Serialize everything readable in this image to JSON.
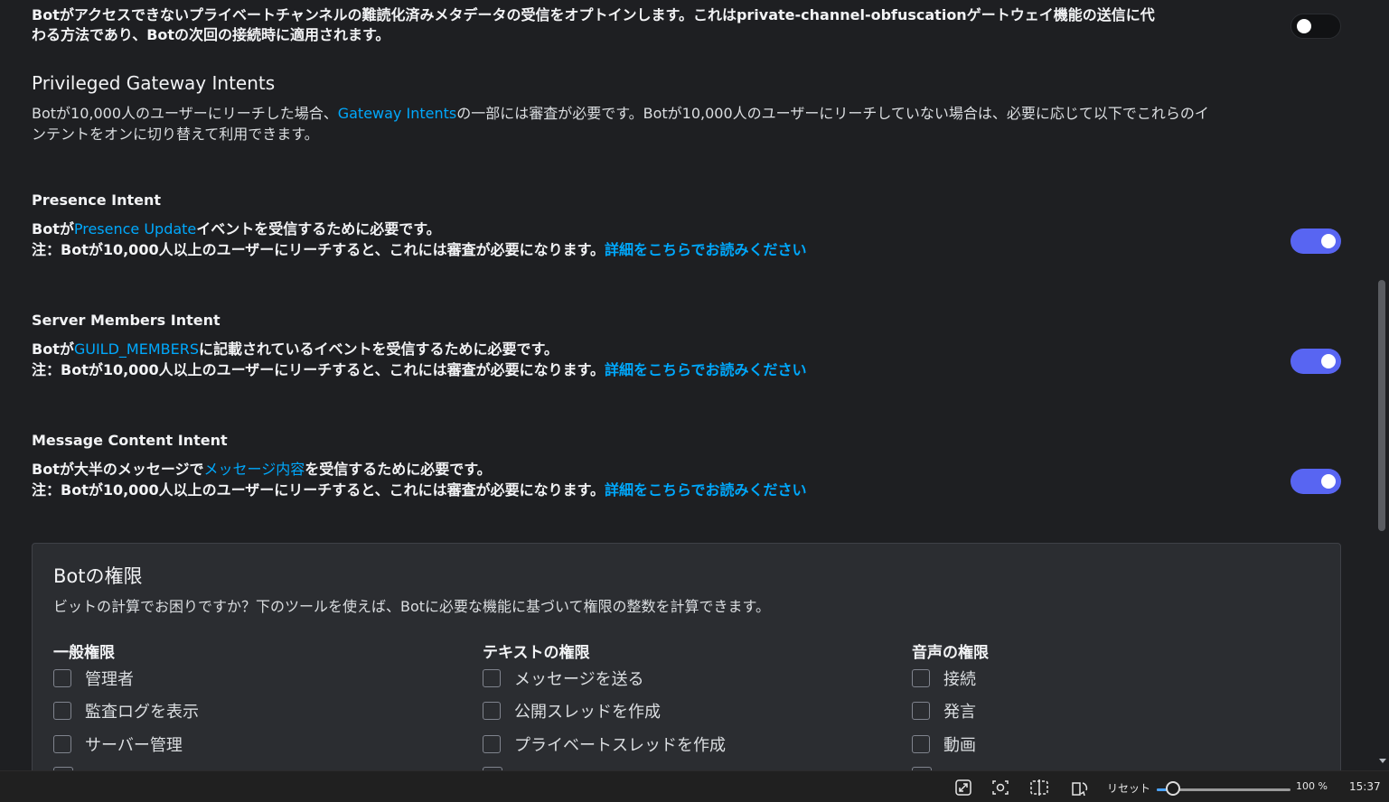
{
  "intro": {
    "line1": "Botがアクセスできないプライベートチャンネルの難読化済みメタデータの受信をオプトインします。これはprivate-channel-obfuscationゲートウェイ機能の送信に代",
    "line2": "わる方法であり、Botの次回の接続時に適用されます。",
    "toggle_on": false
  },
  "privileged": {
    "title": "Privileged Gateway Intents",
    "desc_pre": "Botが10,000人のユーザーにリーチした場合、",
    "desc_link": "Gateway Intents",
    "desc_post": "の一部には審査が必要です。Botが10,000人のユーザーにリーチしていない場合は、必要に応じて以下でこれらのイ",
    "desc_line2": "ンテントをオンに切り替えて利用できます。"
  },
  "intents": [
    {
      "title": "Presence Intent",
      "desc_pre": "Botが",
      "desc_link": "Presence Update",
      "desc_post": "イベントを受信するために必要です。",
      "note": "注：Botが10,000人以上のユーザーにリーチすると、これには審査が必要になります。",
      "note_link": "詳細をこちらでお読みください",
      "toggle_on": true
    },
    {
      "title": "Server Members Intent",
      "desc_pre": "Botが",
      "desc_link": "GUILD_MEMBERS",
      "desc_post": "に記載されているイベントを受信するために必要です。",
      "note": "注：Botが10,000人以上のユーザーにリーチすると、これには審査が必要になります。",
      "note_link": "詳細をこちらでお読みください",
      "toggle_on": true
    },
    {
      "title": "Message Content Intent",
      "desc_pre": "Botが大半のメッセージで",
      "desc_link": "メッセージ内容",
      "desc_post": "を受信するために必要です。",
      "note": "注：Botが10,000人以上のユーザーにリーチすると、これには審査が必要になります。",
      "note_link": "詳細をこちらでお読みください",
      "toggle_on": true
    }
  ],
  "permissions": {
    "title": "Botの権限",
    "desc": "ビットの計算でお困りですか？下のツールを使えば、Botに必要な機能に基づいて権限の整数を計算できます。",
    "columns": [
      {
        "heading": "一般権限",
        "items": [
          "管理者",
          "監査ログを表示",
          "サーバー管理"
        ]
      },
      {
        "heading": "テキストの権限",
        "items": [
          "メッセージを送る",
          "公開スレッドを作成",
          "プライベートスレッドを作成"
        ]
      },
      {
        "heading": "音声の権限",
        "items": [
          "接続",
          "発言",
          "動画"
        ]
      }
    ]
  },
  "taskbar": {
    "reset_label": "リセット",
    "zoom": "100 %",
    "zoom_level": 0.12,
    "time": "15:37",
    "icons": [
      "expand-icon",
      "screenshot-icon",
      "split-view-icon",
      "rotate-icon"
    ]
  },
  "colors": {
    "background": "#1e1f22",
    "panel": "#2b2d31",
    "link": "#00a8fc",
    "toggle_on": "#5865f2"
  }
}
